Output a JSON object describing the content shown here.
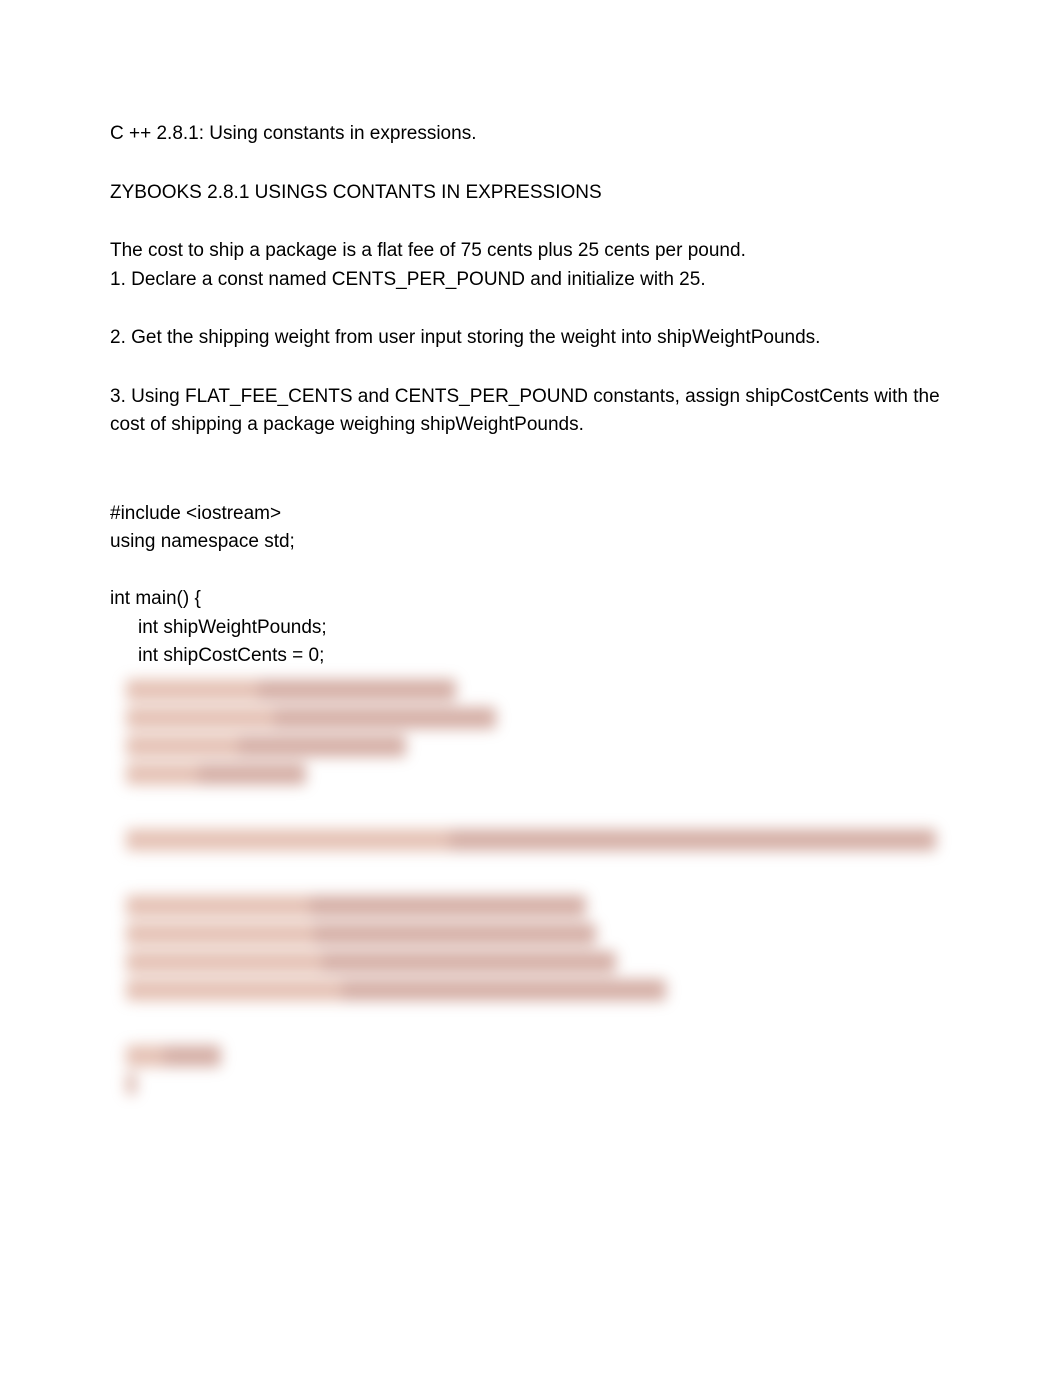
{
  "title": "C ++  2.8.1: Using constants in expressions.",
  "subtitle": "ZYBOOKS 2.8.1 USINGS CONTANTS IN EXPRESSIONS",
  "intro": {
    "line1": "The cost to ship a package is a flat fee of 75 cents plus 25 cents per pound.",
    "line2": "1. Declare a const named CENTS_PER_POUND and initialize with 25."
  },
  "step2": "2. Get the shipping weight from user input storing the weight into shipWeightPounds.",
  "step3": {
    "line1": "3. Using FLAT_FEE_CENTS and CENTS_PER_POUND constants, assign shipCostCents with the",
    "line2": "cost of shipping a package weighing shipWeightPounds."
  },
  "code": {
    "l1": "#include <iostream>",
    "l2": "using namespace std;",
    "l3": "int main() {",
    "l4": "int shipWeightPounds;",
    "l5": "int shipCostCents = 0;"
  },
  "blurred_widths": {
    "g1": [
      330,
      370,
      280,
      180
    ],
    "g2": [
      810
    ],
    "g3": [
      460,
      470,
      490,
      540
    ],
    "g4": [
      95,
      10
    ]
  }
}
